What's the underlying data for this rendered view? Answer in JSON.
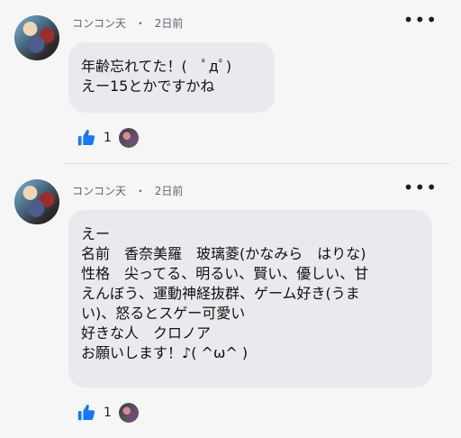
{
  "comments": [
    {
      "author": "コンコン天",
      "separator": "・",
      "time": "2日前",
      "more": "•••",
      "lines": [
        "年齢忘れてた！(　ﾟдﾟ)",
        "えー15とかですかね"
      ],
      "likes": "1"
    },
    {
      "author": "コンコン天",
      "separator": "・",
      "time": "2日前",
      "more": "•••",
      "lines": [
        "えー",
        "名前　香奈美羅　玻璃菱(かなみら　はりな)",
        "性格　尖ってる、明るい、賢い、優しい、甘",
        "えんぼう、運動神経抜群、ゲーム好き(うま",
        "い)、怒るとスゲー可愛い",
        "好きな人　クロノア",
        "お願いします！♪( ^ω^ )"
      ],
      "likes": "1"
    }
  ],
  "colors": {
    "like_blue": "#1877f2",
    "bubble": "#e9eaed",
    "background": "#f6f6f7",
    "meta_text": "#606770"
  },
  "icons": {
    "like": "thumbs-up-icon",
    "more": "more-options-icon"
  }
}
